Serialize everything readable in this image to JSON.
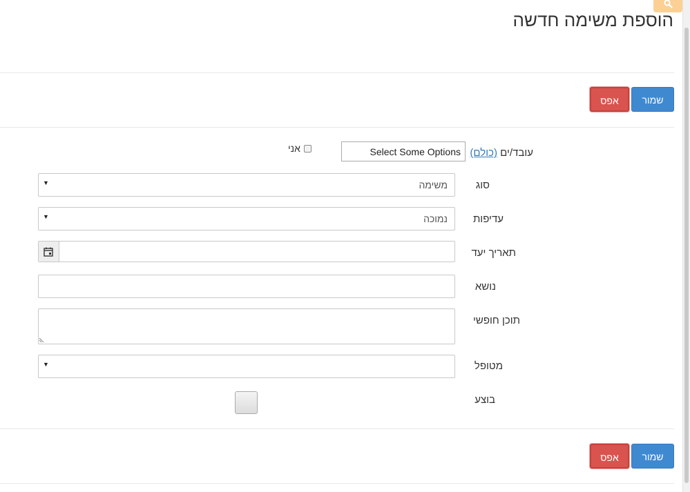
{
  "page": {
    "title": "הוספת משימה חדשה"
  },
  "toolbar_top": {
    "save_label": "שמור",
    "reset_label": "אפס"
  },
  "toolbar_bottom": {
    "save_label": "שמור",
    "reset_label": "אפס"
  },
  "form": {
    "workers": {
      "label": "עובד/ים",
      "all_link": "(כולם)",
      "placeholder": "Select Some Options",
      "me_label": "אני"
    },
    "type": {
      "label": "סוג",
      "value": "משימה"
    },
    "priority": {
      "label": "עדיפות",
      "value": "נמוכה"
    },
    "due_date": {
      "label": "תאריך יעד",
      "value": ""
    },
    "subject": {
      "label": "נושא",
      "value": ""
    },
    "free_text": {
      "label": "תוכן חופשי",
      "value": ""
    },
    "handled_by": {
      "label": "מטופל",
      "value": ""
    },
    "done": {
      "label": "בוצע"
    }
  },
  "colors": {
    "save": "#3f89d1",
    "reset": "#d9534f",
    "search_tab": "#fcd095",
    "link": "#337ab7"
  },
  "icons": [
    "search-icon",
    "calendar-icon",
    "dropdown-arrow-icon",
    "resize-handle-icon"
  ]
}
